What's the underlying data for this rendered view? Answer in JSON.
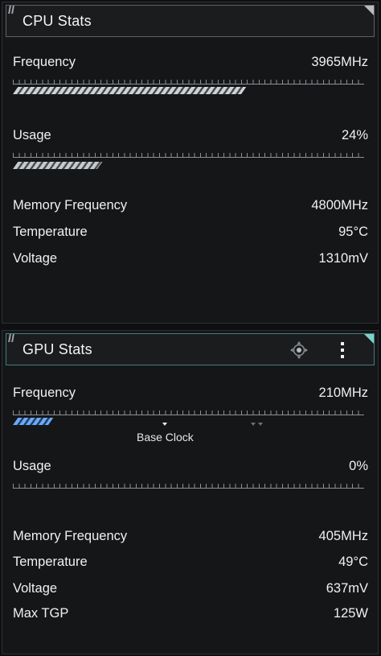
{
  "cpu": {
    "title": "CPU Stats",
    "frequency": {
      "label": "Frequency",
      "value": "3965MHz",
      "level": 0.65
    },
    "usage": {
      "label": "Usage",
      "value": "24%",
      "level": 0.24
    },
    "stats": [
      {
        "label": "Memory Frequency",
        "value": "4800MHz"
      },
      {
        "label": "Temperature",
        "value": "95°C"
      },
      {
        "label": "Voltage",
        "value": "1310mV"
      }
    ]
  },
  "gpu": {
    "title": "GPU Stats",
    "frequency": {
      "label": "Frequency",
      "value": "210MHz",
      "level": 0.1
    },
    "base_clock_label": "Base Clock",
    "usage": {
      "label": "Usage",
      "value": "0%",
      "level": 0
    },
    "stats": [
      {
        "label": "Memory Frequency",
        "value": "405MHz"
      },
      {
        "label": "Temperature",
        "value": "49°C"
      },
      {
        "label": "Voltage",
        "value": "637mV"
      },
      {
        "label": "Max TGP",
        "value": "125W"
      }
    ]
  },
  "colors": {
    "accent": "#7fd1c9",
    "gpu_bar": "#6aa9ff",
    "cpu_bar": "#cfd3d6",
    "background": "#0e0f11"
  },
  "icons": {
    "gpu_drag": "move-crosshair-icon",
    "gpu_more": "more-vertical-icon"
  }
}
